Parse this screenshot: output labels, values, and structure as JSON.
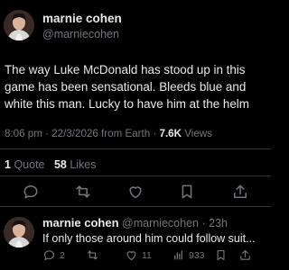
{
  "tweet": {
    "author_name": "marnie cohen",
    "author_handle": "@marniecohen",
    "body": "The way Luke McDonald has stood up in this game has been sensational. Bleeds blue and white this man. Lucky to have him at the helm",
    "time": "8:06 pm",
    "date": "22/3/2026",
    "source": "from Earth",
    "views_count": "7.6K",
    "views_label": "Views",
    "quotes_count": "1",
    "quotes_label": "Quote",
    "likes_count": "58",
    "likes_label": "Likes",
    "actions": [
      "reply-icon",
      "retweet-icon",
      "like-icon",
      "bookmark-icon",
      "share-icon"
    ]
  },
  "reply": {
    "author_name": "marnie cohen",
    "author_handle": "@marniecohen",
    "age": "23h",
    "text": "If only those around him could follow suit...",
    "replies_count": "2",
    "retweets_count": "",
    "likes_count": "11",
    "views_count": "933"
  },
  "colors": {
    "background": "#000000",
    "text": "#e7e9ea",
    "muted": "#71767b",
    "divider": "#2f3336"
  }
}
